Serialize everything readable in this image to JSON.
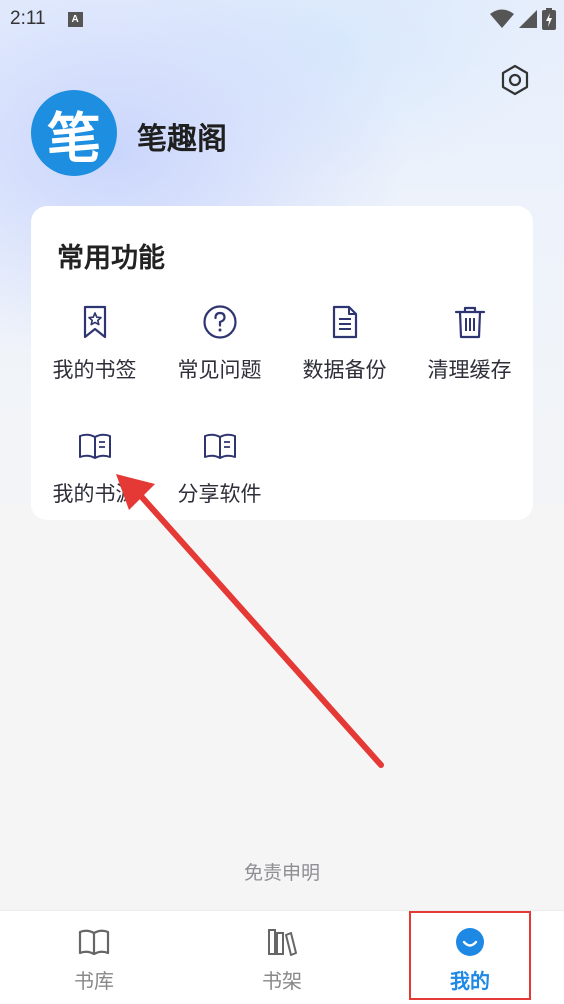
{
  "status_bar": {
    "time": "2:11",
    "notif_letter": "A"
  },
  "header": {
    "app_name": "笔趣阁",
    "avatar_char": "笔"
  },
  "card": {
    "title": "常用功能",
    "items": [
      {
        "label": "我的书签",
        "icon": "bookmark-star-icon"
      },
      {
        "label": "常见问题",
        "icon": "question-circle-icon"
      },
      {
        "label": "数据备份",
        "icon": "document-icon"
      },
      {
        "label": "清理缓存",
        "icon": "trash-icon"
      },
      {
        "label": "我的书源",
        "icon": "open-book-icon"
      },
      {
        "label": "分享软件",
        "icon": "open-book-icon"
      }
    ]
  },
  "disclaimer": "免责申明",
  "tabs": [
    {
      "label": "书库",
      "icon": "open-book-icon",
      "active": false
    },
    {
      "label": "书架",
      "icon": "bookshelf-icon",
      "active": false
    },
    {
      "label": "我的",
      "icon": "smiley-icon",
      "active": true
    }
  ],
  "colors": {
    "accent": "#1e88e5",
    "annotation": "#e53935",
    "avatar": "#1d8ee0"
  }
}
